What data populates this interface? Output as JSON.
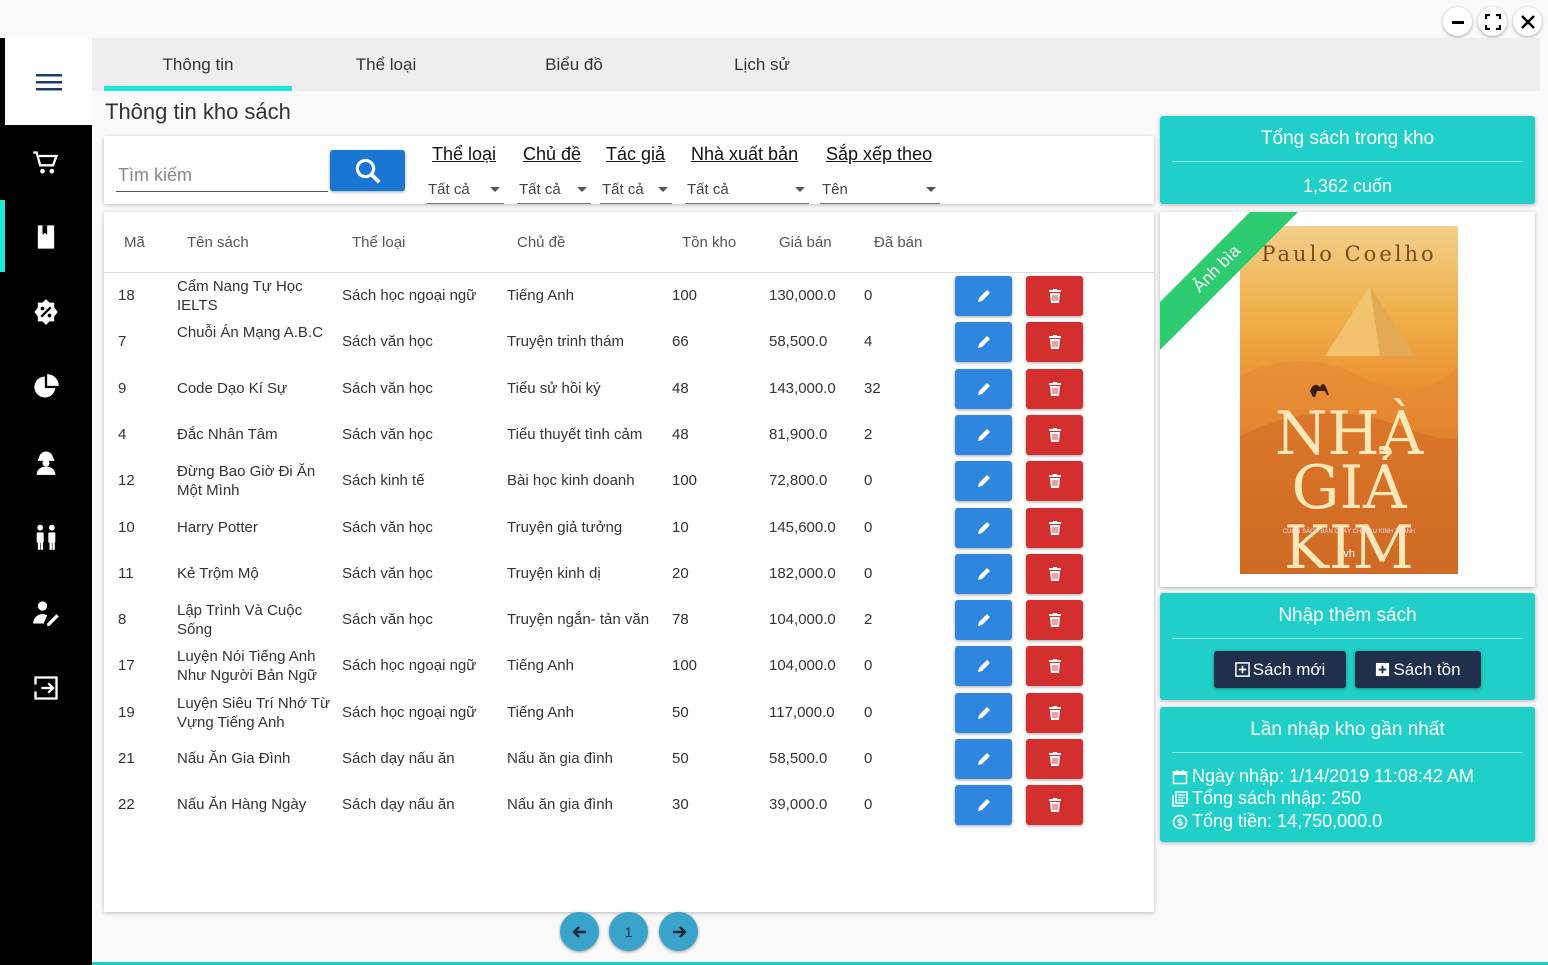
{
  "tabs": [
    "Thông tin",
    "Thể loại",
    "Biểu đồ",
    "Lịch sử"
  ],
  "page_title": "Thông tin kho sách",
  "search": {
    "placeholder": "Tìm kiếm"
  },
  "filters": [
    {
      "label": "Thể loại",
      "value": "Tất cả"
    },
    {
      "label": "Chủ đề",
      "value": "Tất cả"
    },
    {
      "label": "Tác giả",
      "value": "Tất cả"
    },
    {
      "label": "Nhà xuất bản",
      "value": "Tất cả"
    },
    {
      "label": "Sắp xếp theo",
      "value": "Tên"
    }
  ],
  "table": {
    "headers": [
      "Mã",
      "Tên sách",
      "Thể loại",
      "Chủ đề",
      "Tồn kho",
      "Giá bán",
      "Đã bán"
    ],
    "rows": [
      [
        "18",
        "Cẩm Nang Tự Học IELTS",
        "Sách học ngoại ngữ",
        "Tiếng Anh",
        "100",
        "130,000.0",
        "0"
      ],
      [
        "7",
        "Chuỗi Án Mạng A.B.C",
        "Sách văn học",
        "Truyện trinh thám",
        "66",
        "58,500.0",
        "4"
      ],
      [
        "9",
        "Code Dạo Kí Sự",
        "Sách văn học",
        "Tiểu sử hồi ký",
        "48",
        "143,000.0",
        "32"
      ],
      [
        "4",
        "Đắc Nhân Tâm",
        "Sách văn học",
        "Tiểu thuyết tình cảm",
        "48",
        "81,900.0",
        "2"
      ],
      [
        "12",
        "Đừng Bao Giờ Đi Ăn Một Mình",
        "Sách kinh tế",
        "Bài học kinh doanh",
        "100",
        "72,800.0",
        "0"
      ],
      [
        "10",
        "Harry Potter",
        "Sách văn học",
        "Truyện giả tưởng",
        "10",
        "145,600.0",
        "0"
      ],
      [
        "11",
        "Kẻ Trộm Mộ",
        "Sách văn học",
        "Truyện kinh dị",
        "20",
        "182,000.0",
        "0"
      ],
      [
        "8",
        "Lập Trình Và Cuộc Sống",
        "Sách văn học",
        "Truyện ngắn- tản văn",
        "78",
        "104,000.0",
        "2"
      ],
      [
        "17",
        "Luyện Nói Tiếng Anh Như Người Bản Ngữ",
        "Sách học ngoại ngữ",
        "Tiếng Anh",
        "100",
        "104,000.0",
        "0"
      ],
      [
        "19",
        "Luyện Siêu Trí Nhớ Từ Vựng Tiếng Anh",
        "Sách học ngoại ngữ",
        "Tiếng Anh",
        "50",
        "117,000.0",
        "0"
      ],
      [
        "21",
        "Nấu Ăn Gia Đình",
        "Sách dạy nấu ăn",
        "Nấu ăn gia đình",
        "50",
        "58,500.0",
        "0"
      ],
      [
        "22",
        "Nấu Ăn Hàng Ngày",
        "Sách dạy nấu ăn",
        "Nấu ăn gia đình",
        "30",
        "39,000.0",
        "0"
      ]
    ]
  },
  "pagination": {
    "current_page": "1"
  },
  "stock_card": {
    "title": "Tổng sách trong kho",
    "value": "1,362 cuốn"
  },
  "cover": {
    "ribbon": "Ảnh bìa",
    "author": "Paulo Coelho",
    "title_line1": "NHÀ",
    "title_line2": "GIẢ KIM",
    "subtitle": "CUỐN SÁCH BÁN CHẠY CHỈ SAU KINH THÁNH",
    "publisher": "vh"
  },
  "import_card": {
    "title": "Nhập thêm sách",
    "new_book": "Sách mới",
    "stock_book": "Sách tồn"
  },
  "last_import": {
    "title": "Lần nhập kho gần nhất",
    "date": "Ngày nhập: 1/14/2019 11:08:42 AM",
    "total_books": "Tổng sách nhập: 250",
    "total_money": "Tổng tiền: 14,750,000.0"
  },
  "sidebar": {
    "icons": [
      "cart-icon",
      "book-icon",
      "percent-badge-icon",
      "pie-chart-icon",
      "worker-icon",
      "people-icon",
      "user-edit-icon",
      "logout-icon"
    ],
    "active_index": 1
  },
  "colors": {
    "accent": "#1de9d8",
    "teal": "#20cfc7",
    "edit": "#2e86de",
    "delete": "#d32f2f",
    "dark_button": "#1f2f4c"
  }
}
